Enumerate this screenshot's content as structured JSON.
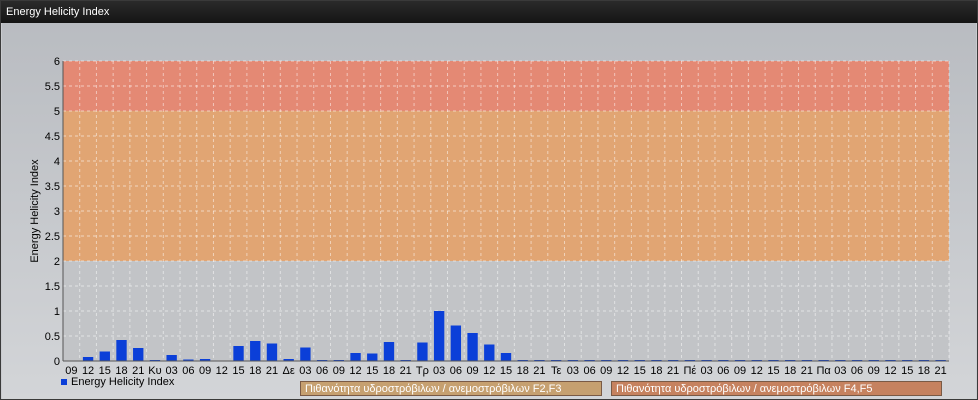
{
  "window": {
    "title": "Energy Helicity Index"
  },
  "colors": {
    "bar": "#0b3fd8",
    "band_low": "#c6a070",
    "band_high": "#c6825f",
    "band_high_fill": "#e8836a",
    "band_mid_fill": "#e6a064"
  },
  "legend": {
    "series_label": "Energy Helicity Index",
    "band_f2f3": "Πιθανότητα υδροστρόβιλων / ανεμοστρόβιλων F2,F3",
    "band_f4f5": "Πιθανότητα υδροστρόβιλων / ανεμοστρόβιλων F4,F5"
  },
  "chart_data": {
    "type": "bar",
    "title": "Energy Helicity Index",
    "ylabel": "Energy Helicity Index",
    "ylim": [
      0,
      6
    ],
    "yticks": [
      "0",
      "0.5",
      "1",
      "1.5",
      "2",
      "2.5",
      "3",
      "3.5",
      "4",
      "4.5",
      "5",
      "5.5",
      "6"
    ],
    "grid": true,
    "bands": [
      {
        "from": 2,
        "to": 5,
        "label": "Πιθανότητα υδροστρόβιλων / ανεμοστρόβιλων F2,F3"
      },
      {
        "from": 5,
        "to": 6,
        "label": "Πιθανότητα υδροστρόβιλων / ανεμοστρόβιλων F4,F5"
      }
    ],
    "categories": [
      "09",
      "12",
      "15",
      "18",
      "21",
      "Κυ",
      "03",
      "06",
      "09",
      "12",
      "15",
      "18",
      "21",
      "Δε",
      "03",
      "06",
      "09",
      "12",
      "15",
      "18",
      "21",
      "Τρ",
      "03",
      "06",
      "09",
      "12",
      "15",
      "18",
      "21",
      "Τε",
      "03",
      "06",
      "09",
      "12",
      "15",
      "18",
      "21",
      "Πέ",
      "03",
      "06",
      "09",
      "12",
      "15",
      "18",
      "21",
      "Πα",
      "03",
      "06",
      "09",
      "12",
      "15",
      "18",
      "21"
    ],
    "series": [
      {
        "name": "Energy Helicity Index",
        "values": [
          0.01,
          0.08,
          0.19,
          0.42,
          0.26,
          0.02,
          0.12,
          0.03,
          0.04,
          0.01,
          0.3,
          0.4,
          0.35,
          0.04,
          0.27,
          0.02,
          0.02,
          0.16,
          0.15,
          0.38,
          0.02,
          0.37,
          1.0,
          0.71,
          0.56,
          0.33,
          0.16,
          0.02,
          0.02,
          0.02,
          0.02,
          0.02,
          0.02,
          0.02,
          0.02,
          0.02,
          0.02,
          0.02,
          0.02,
          0.02,
          0.02,
          0.02,
          0.02,
          0.02,
          0.02,
          0.02,
          0.02,
          0.02,
          0.02,
          0.02,
          0.02,
          0.02,
          0.02
        ]
      }
    ]
  }
}
